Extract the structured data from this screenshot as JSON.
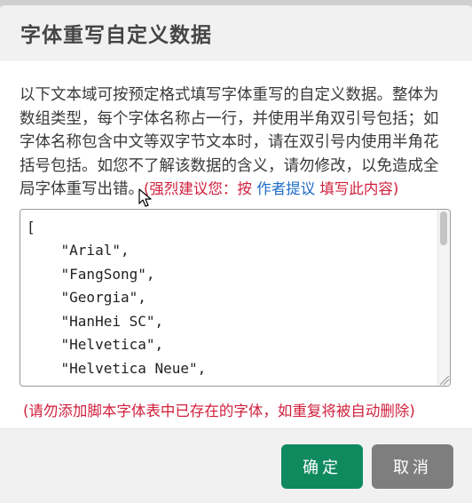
{
  "dialog": {
    "title": "字体重写自定义数据",
    "intro_text": "以下文本域可按预定格式填写字体重写的自定义数据。整体为数组类型，每个字体名称占一行，并使用半角双引号包括；如字体名称包含中文等双字节文本时，请在双引号内使用半角花括号包括。如您不了解该数据的含义，请勿修改，以免造成全局字体重写出错。",
    "hint_prefix": "(强烈建议您：按 ",
    "hint_link": "作者提议",
    "hint_suffix": " 填写此内容)",
    "textarea_value": "[\n    \"Arial\",\n    \"FangSong\",\n    \"Georgia\",\n    \"HanHei SC\",\n    \"Helvetica\",\n    \"Helvetica Neue\",\n    \"KaiTi\",",
    "warning": "(请勿添加脚本字体表中已存在的字体，如重复将被自动删除)"
  },
  "buttons": {
    "confirm": "确定",
    "cancel": "取消"
  },
  "colors": {
    "confirm_bg": "#0f8a5f",
    "cancel_bg": "#7e7e7e",
    "hint_red": "#d11f3c",
    "hint_link": "#1e6cc7"
  },
  "icons": {
    "cursor": "mouse-pointer-icon"
  }
}
